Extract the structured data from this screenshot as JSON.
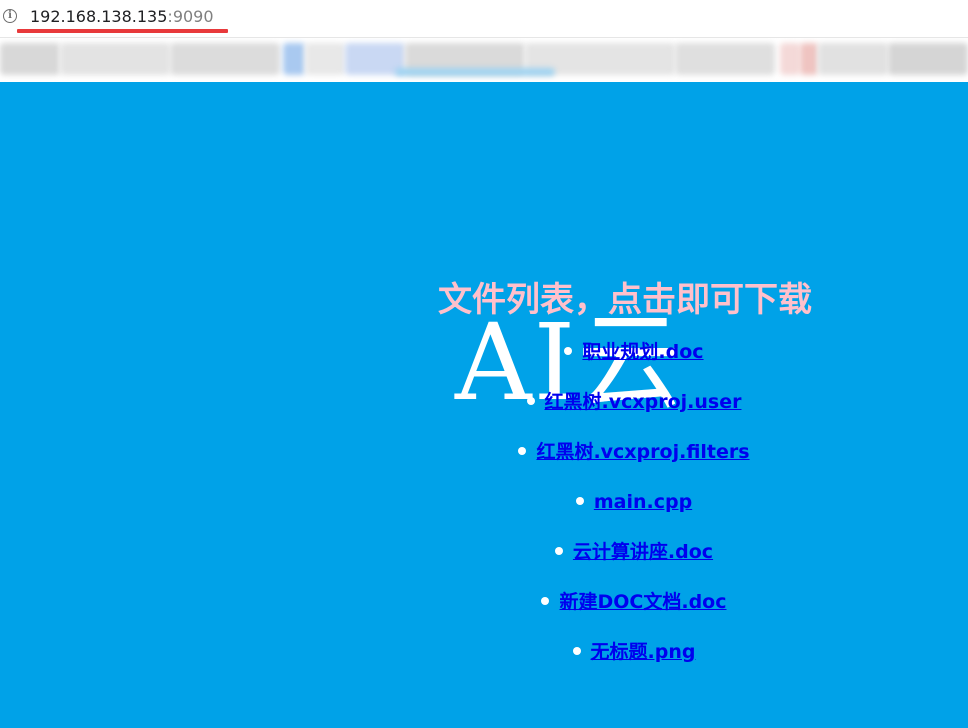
{
  "address_bar": {
    "info_icon": "info-icon",
    "url_host": "192.168.138.135",
    "url_port": ":9090"
  },
  "page": {
    "background_color": "#00a2e8",
    "watermark": "AI云",
    "title": "文件列表，点击即可下载",
    "title_color": "#ffc0cb",
    "files": [
      {
        "name": "职业规划.doc"
      },
      {
        "name": "红黑树.vcxproj.user"
      },
      {
        "name": "红黑树.vcxproj.filters"
      },
      {
        "name": "main.cpp"
      },
      {
        "name": "云计算讲座.doc"
      },
      {
        "name": "新建DOC文档.doc"
      },
      {
        "name": "无标题.png"
      }
    ]
  }
}
